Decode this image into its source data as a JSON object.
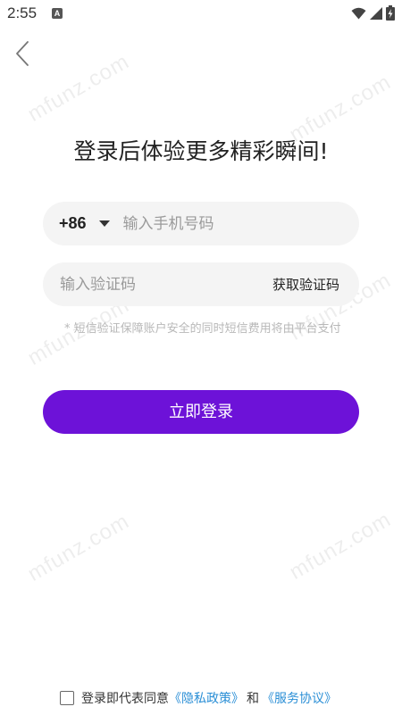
{
  "status_bar": {
    "time": "2:55",
    "notification_icon": "A"
  },
  "icons": {
    "back": "chevron-left-icon",
    "wifi": "wifi-icon",
    "signal": "signal-icon",
    "battery": "battery-charging-icon"
  },
  "watermark": "mfunz.com",
  "title": "登录后体验更多精彩瞬间!",
  "phone": {
    "country_code": "+86",
    "placeholder": "输入手机号码",
    "value": ""
  },
  "code": {
    "placeholder": "输入验证码",
    "value": "",
    "get_code_label": "获取验证码"
  },
  "hint": "* 短信验证保障账户安全的同时短信费用将由平台支付",
  "login_label": "立即登录",
  "agreement": {
    "checked": false,
    "prefix": "登录即代表同意",
    "privacy_link": "《隐私政策》",
    "and": "和",
    "service_link": "《服务协议》"
  },
  "colors": {
    "accent": "#6d12d8",
    "link": "#2b8fd6",
    "field_bg": "#f4f4f4"
  }
}
